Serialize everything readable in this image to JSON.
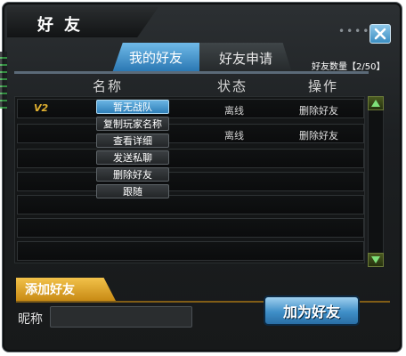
{
  "window": {
    "title": "好友"
  },
  "tabs": [
    {
      "label": "我的好友",
      "active": true
    },
    {
      "label": "好友申请",
      "active": false
    }
  ],
  "friend_count": "好友数量【2/50】",
  "columns": [
    "名称",
    "状态",
    "操作"
  ],
  "rows": [
    {
      "level": "V2",
      "name": "",
      "status": "离线",
      "action": "删除好友"
    },
    {
      "level": "",
      "name": "",
      "status": "离线",
      "action": "删除好友"
    }
  ],
  "context_menu": {
    "items": [
      "暂无战队",
      "复制玩家名称",
      "查看详细",
      "发送私聊",
      "删除好友",
      "跟随"
    ],
    "selected_index": 0
  },
  "add_friend": {
    "section_label": "添加好友",
    "nickname_label": "昵称",
    "nickname_value": "",
    "button_label": "加为好友"
  },
  "colors": {
    "accent_blue": "#3f8fc8",
    "gold": "#e0b030",
    "scroll_green": "#4a5a20"
  }
}
